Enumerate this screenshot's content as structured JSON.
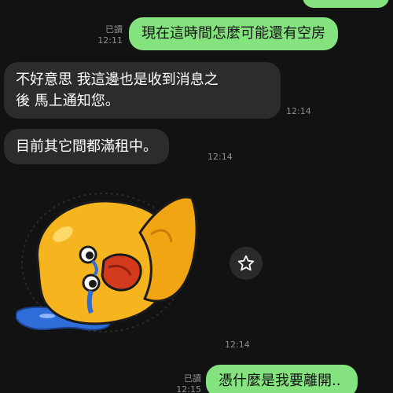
{
  "colors": {
    "background": "#121212",
    "outgoing_bubble": "#84e27f",
    "incoming_bubble": "#2c2c2e",
    "meta_text": "#8e8e8e"
  },
  "messages": [
    {
      "direction": "outgoing",
      "read_label": "已讀",
      "time": "12:11",
      "text": "現在這時間怎麼可能還有空房"
    },
    {
      "direction": "incoming",
      "time": "12:14",
      "text_line1": "不好意思 我這邊也是收到消息之",
      "text_line2": "後 馬上通知您。"
    },
    {
      "direction": "incoming",
      "time": "12:14",
      "text": "目前其它間都滿租中。"
    },
    {
      "direction": "incoming",
      "type": "sticker",
      "sticker_name": "crying-yellow-chick-sticker",
      "time": "12:14"
    },
    {
      "direction": "outgoing",
      "read_label": "已讀",
      "time": "12:15",
      "text": "憑什麼是我要離開.."
    }
  ],
  "icons": {
    "favorite": "star-outline-icon"
  }
}
